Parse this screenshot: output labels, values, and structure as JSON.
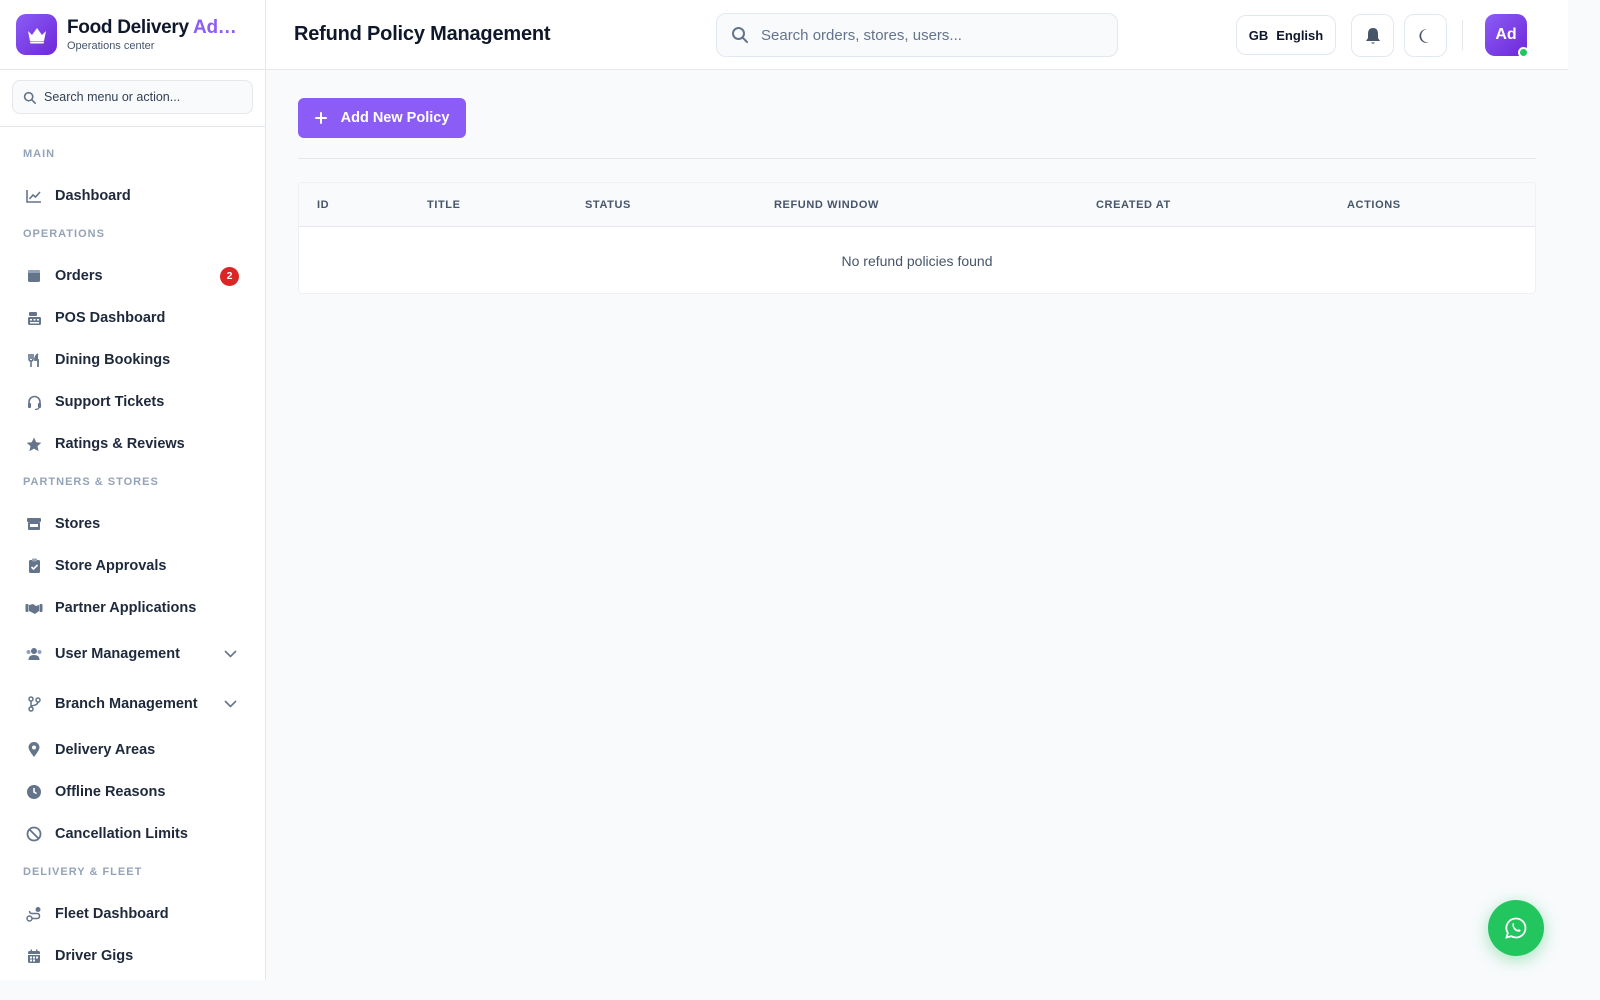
{
  "brand": {
    "title_main": "Food Delivery ",
    "title_accent": "Ad…",
    "subtitle": "Operations center"
  },
  "sidebar": {
    "search_placeholder": "Search menu or action...",
    "sections": {
      "main": "MAIN",
      "operations": "OPERATIONS",
      "partners": "PARTNERS & STORES",
      "fleet": "DELIVERY & FLEET"
    },
    "items": {
      "dashboard": "Dashboard",
      "orders": "Orders",
      "orders_badge": "2",
      "pos": "POS Dashboard",
      "dining": "Dining Bookings",
      "support": "Support Tickets",
      "ratings": "Ratings & Reviews",
      "stores": "Stores",
      "store_approvals": "Store Approvals",
      "partner_apps": "Partner Applications",
      "user_mgmt": "User Management",
      "branch_mgmt": "Branch Management",
      "delivery_areas": "Delivery Areas",
      "offline": "Offline Reasons",
      "cancellation": "Cancellation Limits",
      "fleet_dashboard": "Fleet Dashboard",
      "driver_gigs": "Driver Gigs"
    }
  },
  "header": {
    "title": "Refund Policy Management",
    "search_placeholder": "Search orders, stores, users...",
    "lang_code": "GB",
    "lang_label": "English",
    "avatar_initials": "Ad"
  },
  "main": {
    "add_button": "Add New Policy",
    "columns": [
      "ID",
      "TITLE",
      "STATUS",
      "REFUND WINDOW",
      "CREATED AT",
      "ACTIONS"
    ],
    "empty_message": "No refund policies found"
  },
  "colors": {
    "accent": "#8b5cf6",
    "badge": "#dc2626",
    "whatsapp": "#22c55e"
  }
}
